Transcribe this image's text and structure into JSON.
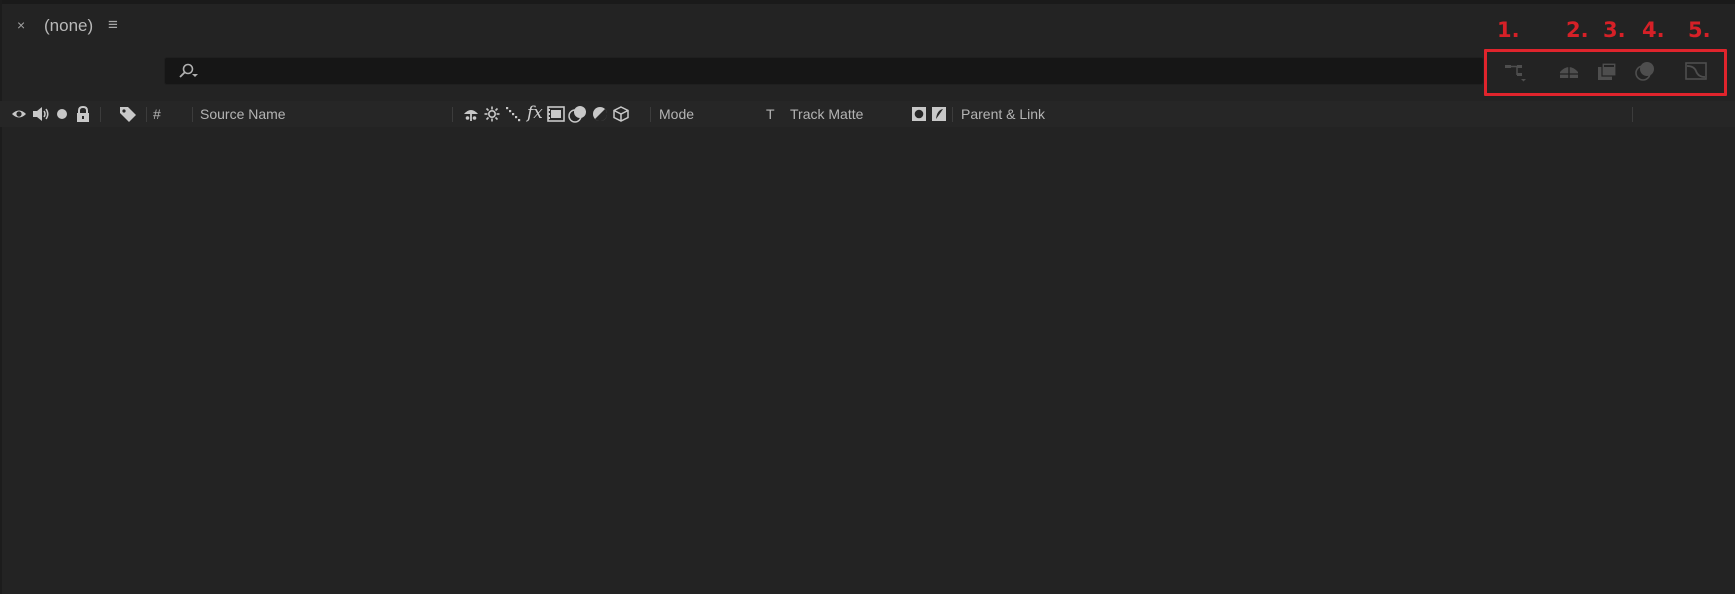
{
  "panel": {
    "close_glyph": "×",
    "title": "(none)",
    "menu_glyph": "≡"
  },
  "search": {
    "placeholder": "",
    "value": "",
    "icon": "search-icon"
  },
  "toolbar": {
    "switches": [
      {
        "name": "comp-flowchart-icon",
        "annotation": "1."
      },
      {
        "name": "draft-3d-icon",
        "annotation": "2."
      },
      {
        "name": "hide-shy-layers-icon",
        "annotation": "3."
      },
      {
        "name": "frame-blending-icon",
        "annotation": "4."
      },
      {
        "name": "motion-blur-icon",
        "annotation": "5."
      }
    ],
    "highlight_color": "#e0242c"
  },
  "columns": {
    "av_features": [
      "eye-icon",
      "audio-icon",
      "solo-icon",
      "lock-icon"
    ],
    "label_icon": "label-tag-icon",
    "number": "#",
    "source_name": "Source Name",
    "switches": [
      "shy-icon",
      "collapse-icon",
      "quality-icon",
      "effects-icon",
      "frame-blend-icon",
      "motion-blur-icon",
      "adjustment-layer-icon",
      "3d-layer-icon"
    ],
    "fx_label": "fx",
    "mode": "Mode",
    "t": "T",
    "track_matte": "Track Matte",
    "parent_link": "Parent & Link"
  },
  "colors": {
    "background": "#232323",
    "header": "#262626",
    "search_bg": "#161616",
    "annotation_red": "#d62027"
  }
}
